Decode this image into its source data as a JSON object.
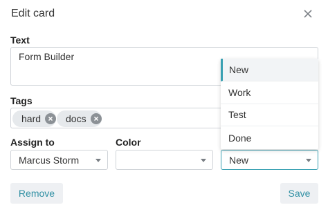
{
  "dialog": {
    "title": "Edit card"
  },
  "text_field": {
    "label": "Text",
    "value": "Form Builder"
  },
  "tags_field": {
    "label": "Tags",
    "tags": [
      "hard",
      "docs"
    ]
  },
  "assign_field": {
    "label": "Assign to",
    "value": "Marcus Storm"
  },
  "color_field": {
    "label": "Color",
    "value": ""
  },
  "status_field": {
    "value": "New",
    "options": [
      "New",
      "Work",
      "Test",
      "Done"
    ],
    "selected_option": "New"
  },
  "actions": {
    "remove_label": "Remove",
    "save_label": "Save"
  },
  "colors": {
    "accent": "#39a0b2",
    "button_text": "#2f8fa3",
    "button_bg": "#eef0f3"
  },
  "icons": {
    "close": "close-icon",
    "tag_remove": "tag-remove-icon",
    "dropdown": "chevron-down-icon"
  }
}
